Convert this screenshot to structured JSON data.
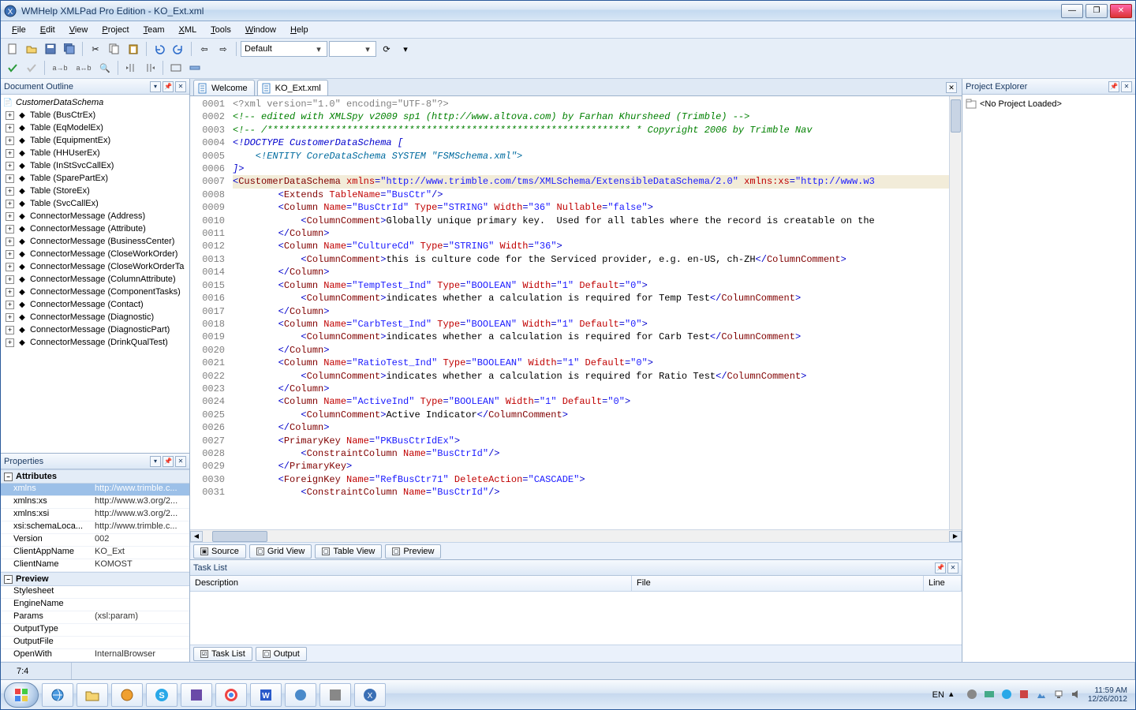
{
  "title": "WMHelp XMLPad Pro Edition - KO_Ext.xml",
  "menus": [
    "File",
    "Edit",
    "View",
    "Project",
    "Team",
    "XML",
    "Tools",
    "Window",
    "Help"
  ],
  "menu_underline_index": [
    0,
    0,
    0,
    0,
    0,
    0,
    0,
    0,
    0
  ],
  "combo_default": "Default",
  "panels": {
    "outline": "Document Outline",
    "properties": "Properties",
    "project_explorer": "Project Explorer",
    "task_list": "Task List"
  },
  "outline_root": "CustomerDataSchema",
  "outline_nodes": [
    "Table (BusCtrEx)",
    "Table (EqModelEx)",
    "Table (EquipmentEx)",
    "Table (HHUserEx)",
    "Table (InStSvcCallEx)",
    "Table (SparePartEx)",
    "Table (StoreEx)",
    "Table (SvcCallEx)",
    "ConnectorMessage (Address)",
    "ConnectorMessage (Attribute)",
    "ConnectorMessage (BusinessCenter)",
    "ConnectorMessage (CloseWorkOrder)",
    "ConnectorMessage (CloseWorkOrderTa",
    "ConnectorMessage (ColumnAttribute)",
    "ConnectorMessage (ComponentTasks)",
    "ConnectorMessage (Contact)",
    "ConnectorMessage (Diagnostic)",
    "ConnectorMessage (DiagnosticPart)",
    "ConnectorMessage (DrinkQualTest)"
  ],
  "attributes_group": "Attributes",
  "preview_group": "Preview",
  "attributes": [
    {
      "n": "xmlns",
      "v": "http://www.trimble.c...",
      "sel": true
    },
    {
      "n": "xmlns:xs",
      "v": "http://www.w3.org/2..."
    },
    {
      "n": "xmlns:xsi",
      "v": "http://www.w3.org/2..."
    },
    {
      "n": "xsi:schemaLoca...",
      "v": "http://www.trimble.c..."
    },
    {
      "n": "Version",
      "v": "002"
    },
    {
      "n": "ClientAppName",
      "v": "KO_Ext"
    },
    {
      "n": "ClientName",
      "v": "KOMOST"
    }
  ],
  "preview_rows": [
    {
      "n": "Stylesheet",
      "v": ""
    },
    {
      "n": "EngineName",
      "v": ""
    },
    {
      "n": "Params",
      "v": "(xsl:param)"
    },
    {
      "n": "OutputType",
      "v": ""
    },
    {
      "n": "OutputFile",
      "v": ""
    },
    {
      "n": "OpenWith",
      "v": "InternalBrowser"
    }
  ],
  "editor_tabs": [
    {
      "label": "Welcome",
      "active": false
    },
    {
      "label": "KO_Ext.xml",
      "active": true
    }
  ],
  "view_tabs": [
    "Source",
    "Grid View",
    "Table View",
    "Preview"
  ],
  "bottom_tabs": [
    "Task List",
    "Output"
  ],
  "tasklist_cols": {
    "desc": "Description",
    "file": "File",
    "line": "Line"
  },
  "project_placeholder": "<No Project Loaded>",
  "status_pos": "7:4",
  "tray": {
    "lang": "EN",
    "time": "11:59 AM",
    "date": "12/26/2012"
  },
  "code_lines": [
    {
      "n": "0001",
      "seg": [
        [
          "pi",
          "<?xml version=\"1.0\" encoding=\"UTF-8\"?>"
        ]
      ]
    },
    {
      "n": "0002",
      "seg": [
        [
          "cm",
          "<!-- edited with XMLSpy v2009 sp1 (http://www.altova.com) by Farhan Khursheed (Trimble) -->"
        ]
      ]
    },
    {
      "n": "0003",
      "seg": [
        [
          "cm",
          "<!-- /**************************************************************** * Copyright 2006 by Trimble Nav"
        ]
      ]
    },
    {
      "n": "0004",
      "seg": [
        [
          "dt",
          "<!DOCTYPE CustomerDataSchema ["
        ]
      ]
    },
    {
      "n": "0005",
      "seg": [
        [
          "en",
          "    <!ENTITY CoreDataSchema SYSTEM \"FSMSchema.xml\">"
        ]
      ]
    },
    {
      "n": "0006",
      "seg": [
        [
          "dt",
          "]>"
        ]
      ]
    },
    {
      "n": "0007",
      "hl": true,
      "seg": [
        [
          "brace",
          "<"
        ],
        [
          "tg",
          "CustomerDataSchema "
        ],
        [
          "an",
          "xmlns"
        ],
        [
          "brace",
          "="
        ],
        [
          "av",
          "\"http://www.trimble.com/tms/XMLSchema/ExtensibleDataSchema/2.0\""
        ],
        [
          "tx",
          " "
        ],
        [
          "an",
          "xmlns:xs"
        ],
        [
          "brace",
          "="
        ],
        [
          "av",
          "\"http://www.w3"
        ]
      ]
    },
    {
      "n": "0008",
      "seg": [
        [
          "tx",
          "        "
        ],
        [
          "brace",
          "<"
        ],
        [
          "tg",
          "Extends "
        ],
        [
          "an",
          "TableName"
        ],
        [
          "brace",
          "="
        ],
        [
          "av",
          "\"BusCtr\""
        ],
        [
          "brace",
          "/>"
        ]
      ]
    },
    {
      "n": "0009",
      "seg": [
        [
          "tx",
          "        "
        ],
        [
          "brace",
          "<"
        ],
        [
          "tg",
          "Column "
        ],
        [
          "an",
          "Name"
        ],
        [
          "brace",
          "="
        ],
        [
          "av",
          "\"BusCtrId\""
        ],
        [
          "tx",
          " "
        ],
        [
          "an",
          "Type"
        ],
        [
          "brace",
          "="
        ],
        [
          "av",
          "\"STRING\""
        ],
        [
          "tx",
          " "
        ],
        [
          "an",
          "Width"
        ],
        [
          "brace",
          "="
        ],
        [
          "av",
          "\"36\""
        ],
        [
          "tx",
          " "
        ],
        [
          "an",
          "Nullable"
        ],
        [
          "brace",
          "="
        ],
        [
          "av",
          "\"false\""
        ],
        [
          "brace",
          ">"
        ]
      ]
    },
    {
      "n": "0010",
      "seg": [
        [
          "tx",
          "            "
        ],
        [
          "brace",
          "<"
        ],
        [
          "tg",
          "ColumnComment"
        ],
        [
          "brace",
          ">"
        ],
        [
          "tx",
          "Globally unique primary key.  Used for all tables where the record is creatable on the"
        ]
      ]
    },
    {
      "n": "0011",
      "seg": [
        [
          "tx",
          "        "
        ],
        [
          "brace",
          "</"
        ],
        [
          "tg",
          "Column"
        ],
        [
          "brace",
          ">"
        ]
      ]
    },
    {
      "n": "0012",
      "seg": [
        [
          "tx",
          "        "
        ],
        [
          "brace",
          "<"
        ],
        [
          "tg",
          "Column "
        ],
        [
          "an",
          "Name"
        ],
        [
          "brace",
          "="
        ],
        [
          "av",
          "\"CultureCd\""
        ],
        [
          "tx",
          " "
        ],
        [
          "an",
          "Type"
        ],
        [
          "brace",
          "="
        ],
        [
          "av",
          "\"STRING\""
        ],
        [
          "tx",
          " "
        ],
        [
          "an",
          "Width"
        ],
        [
          "brace",
          "="
        ],
        [
          "av",
          "\"36\""
        ],
        [
          "brace",
          ">"
        ]
      ]
    },
    {
      "n": "0013",
      "seg": [
        [
          "tx",
          "            "
        ],
        [
          "brace",
          "<"
        ],
        [
          "tg",
          "ColumnComment"
        ],
        [
          "brace",
          ">"
        ],
        [
          "tx",
          "this is culture code for the Serviced provider, e.g. en-US, ch-ZH"
        ],
        [
          "brace",
          "</"
        ],
        [
          "tg",
          "ColumnComment"
        ],
        [
          "brace",
          ">"
        ]
      ]
    },
    {
      "n": "0014",
      "seg": [
        [
          "tx",
          "        "
        ],
        [
          "brace",
          "</"
        ],
        [
          "tg",
          "Column"
        ],
        [
          "brace",
          ">"
        ]
      ]
    },
    {
      "n": "0015",
      "seg": [
        [
          "tx",
          "        "
        ],
        [
          "brace",
          "<"
        ],
        [
          "tg",
          "Column "
        ],
        [
          "an",
          "Name"
        ],
        [
          "brace",
          "="
        ],
        [
          "av",
          "\"TempTest_Ind\""
        ],
        [
          "tx",
          " "
        ],
        [
          "an",
          "Type"
        ],
        [
          "brace",
          "="
        ],
        [
          "av",
          "\"BOOLEAN\""
        ],
        [
          "tx",
          " "
        ],
        [
          "an",
          "Width"
        ],
        [
          "brace",
          "="
        ],
        [
          "av",
          "\"1\""
        ],
        [
          "tx",
          " "
        ],
        [
          "an",
          "Default"
        ],
        [
          "brace",
          "="
        ],
        [
          "av",
          "\"0\""
        ],
        [
          "brace",
          ">"
        ]
      ]
    },
    {
      "n": "0016",
      "seg": [
        [
          "tx",
          "            "
        ],
        [
          "brace",
          "<"
        ],
        [
          "tg",
          "ColumnComment"
        ],
        [
          "brace",
          ">"
        ],
        [
          "tx",
          "indicates whether a calculation is required for Temp Test"
        ],
        [
          "brace",
          "</"
        ],
        [
          "tg",
          "ColumnComment"
        ],
        [
          "brace",
          ">"
        ]
      ]
    },
    {
      "n": "0017",
      "seg": [
        [
          "tx",
          "        "
        ],
        [
          "brace",
          "</"
        ],
        [
          "tg",
          "Column"
        ],
        [
          "brace",
          ">"
        ]
      ]
    },
    {
      "n": "0018",
      "seg": [
        [
          "tx",
          "        "
        ],
        [
          "brace",
          "<"
        ],
        [
          "tg",
          "Column "
        ],
        [
          "an",
          "Name"
        ],
        [
          "brace",
          "="
        ],
        [
          "av",
          "\"CarbTest_Ind\""
        ],
        [
          "tx",
          " "
        ],
        [
          "an",
          "Type"
        ],
        [
          "brace",
          "="
        ],
        [
          "av",
          "\"BOOLEAN\""
        ],
        [
          "tx",
          " "
        ],
        [
          "an",
          "Width"
        ],
        [
          "brace",
          "="
        ],
        [
          "av",
          "\"1\""
        ],
        [
          "tx",
          " "
        ],
        [
          "an",
          "Default"
        ],
        [
          "brace",
          "="
        ],
        [
          "av",
          "\"0\""
        ],
        [
          "brace",
          ">"
        ]
      ]
    },
    {
      "n": "0019",
      "seg": [
        [
          "tx",
          "            "
        ],
        [
          "brace",
          "<"
        ],
        [
          "tg",
          "ColumnComment"
        ],
        [
          "brace",
          ">"
        ],
        [
          "tx",
          "indicates whether a calculation is required for Carb Test"
        ],
        [
          "brace",
          "</"
        ],
        [
          "tg",
          "ColumnComment"
        ],
        [
          "brace",
          ">"
        ]
      ]
    },
    {
      "n": "0020",
      "seg": [
        [
          "tx",
          "        "
        ],
        [
          "brace",
          "</"
        ],
        [
          "tg",
          "Column"
        ],
        [
          "brace",
          ">"
        ]
      ]
    },
    {
      "n": "0021",
      "seg": [
        [
          "tx",
          "        "
        ],
        [
          "brace",
          "<"
        ],
        [
          "tg",
          "Column "
        ],
        [
          "an",
          "Name"
        ],
        [
          "brace",
          "="
        ],
        [
          "av",
          "\"RatioTest_Ind\""
        ],
        [
          "tx",
          " "
        ],
        [
          "an",
          "Type"
        ],
        [
          "brace",
          "="
        ],
        [
          "av",
          "\"BOOLEAN\""
        ],
        [
          "tx",
          " "
        ],
        [
          "an",
          "Width"
        ],
        [
          "brace",
          "="
        ],
        [
          "av",
          "\"1\""
        ],
        [
          "tx",
          " "
        ],
        [
          "an",
          "Default"
        ],
        [
          "brace",
          "="
        ],
        [
          "av",
          "\"0\""
        ],
        [
          "brace",
          ">"
        ]
      ]
    },
    {
      "n": "0022",
      "seg": [
        [
          "tx",
          "            "
        ],
        [
          "brace",
          "<"
        ],
        [
          "tg",
          "ColumnComment"
        ],
        [
          "brace",
          ">"
        ],
        [
          "tx",
          "indicates whether a calculation is required for Ratio Test"
        ],
        [
          "brace",
          "</"
        ],
        [
          "tg",
          "ColumnComment"
        ],
        [
          "brace",
          ">"
        ]
      ]
    },
    {
      "n": "0023",
      "seg": [
        [
          "tx",
          "        "
        ],
        [
          "brace",
          "</"
        ],
        [
          "tg",
          "Column"
        ],
        [
          "brace",
          ">"
        ]
      ]
    },
    {
      "n": "0024",
      "seg": [
        [
          "tx",
          "        "
        ],
        [
          "brace",
          "<"
        ],
        [
          "tg",
          "Column "
        ],
        [
          "an",
          "Name"
        ],
        [
          "brace",
          "="
        ],
        [
          "av",
          "\"ActiveInd\""
        ],
        [
          "tx",
          " "
        ],
        [
          "an",
          "Type"
        ],
        [
          "brace",
          "="
        ],
        [
          "av",
          "\"BOOLEAN\""
        ],
        [
          "tx",
          " "
        ],
        [
          "an",
          "Width"
        ],
        [
          "brace",
          "="
        ],
        [
          "av",
          "\"1\""
        ],
        [
          "tx",
          " "
        ],
        [
          "an",
          "Default"
        ],
        [
          "brace",
          "="
        ],
        [
          "av",
          "\"0\""
        ],
        [
          "brace",
          ">"
        ]
      ]
    },
    {
      "n": "0025",
      "seg": [
        [
          "tx",
          "            "
        ],
        [
          "brace",
          "<"
        ],
        [
          "tg",
          "ColumnComment"
        ],
        [
          "brace",
          ">"
        ],
        [
          "tx",
          "Active Indicator"
        ],
        [
          "brace",
          "</"
        ],
        [
          "tg",
          "ColumnComment"
        ],
        [
          "brace",
          ">"
        ]
      ]
    },
    {
      "n": "0026",
      "seg": [
        [
          "tx",
          "        "
        ],
        [
          "brace",
          "</"
        ],
        [
          "tg",
          "Column"
        ],
        [
          "brace",
          ">"
        ]
      ]
    },
    {
      "n": "0027",
      "seg": [
        [
          "tx",
          "        "
        ],
        [
          "brace",
          "<"
        ],
        [
          "tg",
          "PrimaryKey "
        ],
        [
          "an",
          "Name"
        ],
        [
          "brace",
          "="
        ],
        [
          "av",
          "\"PKBusCtrIdEx\""
        ],
        [
          "brace",
          ">"
        ]
      ]
    },
    {
      "n": "0028",
      "seg": [
        [
          "tx",
          "            "
        ],
        [
          "brace",
          "<"
        ],
        [
          "tg",
          "ConstraintColumn "
        ],
        [
          "an",
          "Name"
        ],
        [
          "brace",
          "="
        ],
        [
          "av",
          "\"BusCtrId\""
        ],
        [
          "brace",
          "/>"
        ]
      ]
    },
    {
      "n": "0029",
      "seg": [
        [
          "tx",
          "        "
        ],
        [
          "brace",
          "</"
        ],
        [
          "tg",
          "PrimaryKey"
        ],
        [
          "brace",
          ">"
        ]
      ]
    },
    {
      "n": "0030",
      "seg": [
        [
          "tx",
          "        "
        ],
        [
          "brace",
          "<"
        ],
        [
          "tg",
          "ForeignKey "
        ],
        [
          "an",
          "Name"
        ],
        [
          "brace",
          "="
        ],
        [
          "av",
          "\"RefBusCtr71\""
        ],
        [
          "tx",
          " "
        ],
        [
          "an",
          "DeleteAction"
        ],
        [
          "brace",
          "="
        ],
        [
          "av",
          "\"CASCADE\""
        ],
        [
          "brace",
          ">"
        ]
      ]
    },
    {
      "n": "0031",
      "seg": [
        [
          "tx",
          "            "
        ],
        [
          "brace",
          "<"
        ],
        [
          "tg",
          "ConstraintColumn "
        ],
        [
          "an",
          "Name"
        ],
        [
          "brace",
          "="
        ],
        [
          "av",
          "\"BusCtrId\""
        ],
        [
          "brace",
          "/>"
        ]
      ]
    }
  ]
}
